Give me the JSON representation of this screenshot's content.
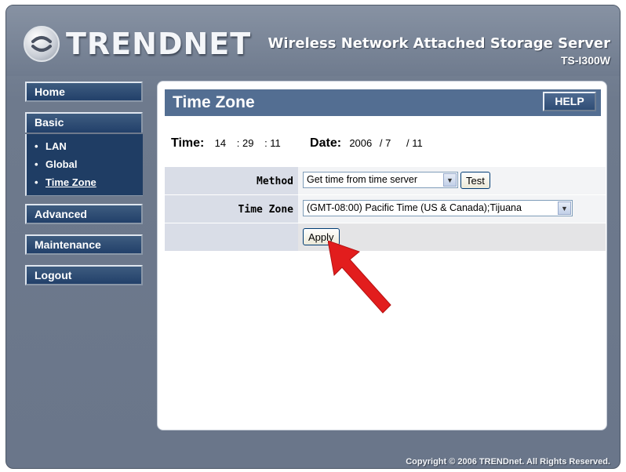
{
  "header": {
    "logo_text": "TRENDNET",
    "product_title": "Wireless Network Attached Storage Server",
    "model": "TS-I300W"
  },
  "nav": {
    "home": "Home",
    "basic": "Basic",
    "basic_items": [
      {
        "label": "LAN"
      },
      {
        "label": "Global"
      },
      {
        "label": "Time Zone"
      }
    ],
    "advanced": "Advanced",
    "maintenance": "Maintenance",
    "logout": "Logout"
  },
  "panel": {
    "title": "Time Zone",
    "help": "HELP",
    "time_label": "Time:",
    "time_h": "14",
    "time_m": "29",
    "time_s": "11",
    "date_label": "Date:",
    "date_y": "2006",
    "date_m": "7",
    "date_d": "11",
    "method_label": "Method",
    "method_value": "Get time from time server",
    "test": "Test",
    "timezone_label": "Time Zone",
    "timezone_value": "(GMT-08:00) Pacific Time (US & Canada);Tijuana",
    "apply": "Apply"
  },
  "footer": {
    "copyright": "Copyright © 2006 TRENDnet. All Rights Reserved."
  },
  "colors": {
    "nav_button": "#22406a",
    "panel_header": "#536e92",
    "annotation_arrow": "#e21d1d"
  }
}
